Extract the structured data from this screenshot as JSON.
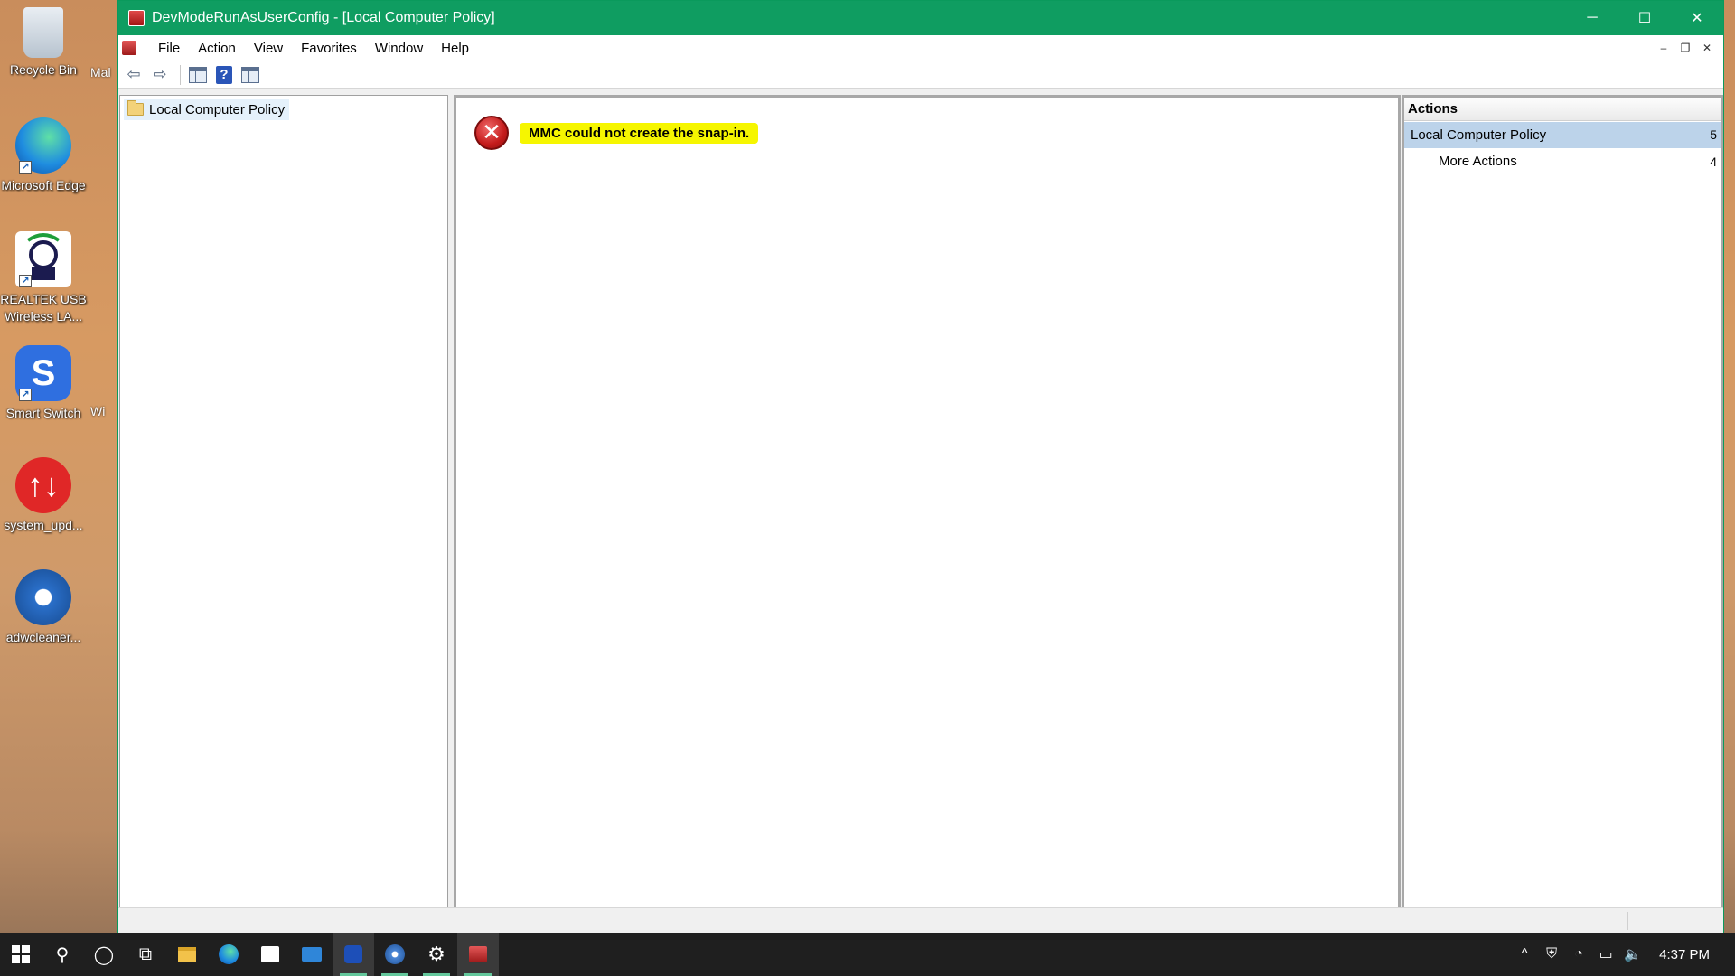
{
  "desktop": {
    "icons": [
      {
        "label": "Recycle Bin"
      },
      {
        "label": "Microsoft Edge"
      },
      {
        "label": "REALTEK USB Wireless LA..."
      },
      {
        "label": "Smart Switch"
      },
      {
        "label": "system_upd..."
      },
      {
        "label": "adwcleaner..."
      }
    ],
    "partial_labels": [
      "Mal",
      "Wi"
    ]
  },
  "window": {
    "title": "DevModeRunAsUserConfig - [Local Computer Policy]",
    "controls": {
      "minimize": "─",
      "maximize": "☐",
      "close": "✕"
    },
    "menu": [
      "File",
      "Action",
      "View",
      "Favorites",
      "Window",
      "Help"
    ],
    "mdi_controls": {
      "minimize": "‒",
      "restore": "❐",
      "close": "✕"
    },
    "toolbar": {
      "back": "⇦",
      "forward": "⇨",
      "help": "?"
    }
  },
  "tree": {
    "root_label": "Local Computer Policy"
  },
  "result": {
    "error_message": "MMC could not create the snap-in.",
    "error_glyph": "✕",
    "highlight_color": "#f6f600"
  },
  "actions": {
    "header": "Actions",
    "group_label": "Local Computer Policy",
    "group_arrow": "5",
    "items": [
      {
        "label": "More Actions",
        "arrow": "4"
      }
    ]
  },
  "taskbar": {
    "search_glyph": "⚲",
    "cortana_glyph": "◯",
    "taskview_glyph": "⧉",
    "apps": [
      "file-explorer",
      "edge",
      "store",
      "mail",
      "malwarebytes",
      "chrome-like",
      "settings",
      "mmc"
    ],
    "tray": {
      "chevron": "^",
      "clock": "4:37 PM"
    }
  },
  "colors": {
    "titlebar": "#0f9d61",
    "selection": "#bcd3ea",
    "taskbar": "#1f1f1f"
  }
}
